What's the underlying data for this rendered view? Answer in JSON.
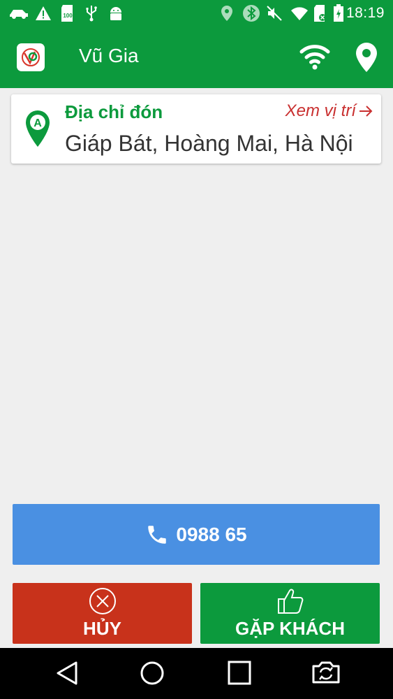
{
  "status_bar": {
    "time": "18:19",
    "badge_text": "100",
    "icons": [
      "car-icon",
      "warning-icon",
      "sd-card-icon",
      "usb-icon",
      "android-icon",
      "location-icon",
      "bluetooth-icon",
      "mute-icon",
      "wifi-icon",
      "no-sim-icon",
      "battery-charging-icon"
    ]
  },
  "app_bar": {
    "title": "Vũ Gia",
    "icons": [
      "app-logo",
      "wifi-icon",
      "location-pin-icon"
    ]
  },
  "address_card": {
    "label": "Địa chỉ đón",
    "link_label": "Xem vị trí",
    "address": "Giáp Bát, Hoàng Mai, Hà Nội",
    "pin_letter": "A"
  },
  "call_button": {
    "number": "0988 65",
    "icon": "phone-icon"
  },
  "actions": {
    "cancel_label": "HỦY",
    "cancel_icon": "close-circle-icon",
    "meet_label": "GẶP KHÁCH",
    "meet_icon": "thumbs-up-icon"
  },
  "nav_bar": {
    "icons": [
      "back-icon",
      "home-icon",
      "recents-icon",
      "switch-camera-icon"
    ]
  },
  "colors": {
    "brand_green": "#0c9a3d",
    "call_blue": "#4a90e2",
    "cancel_red": "#c8321b",
    "link_red": "#c93030",
    "background": "#efefef"
  }
}
